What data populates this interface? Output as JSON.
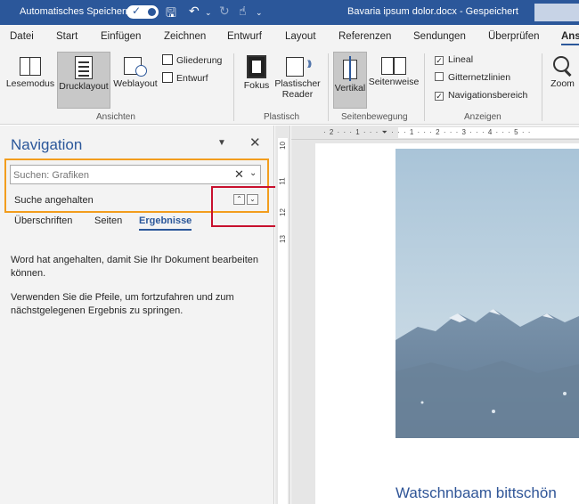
{
  "titlebar": {
    "autosave_label": "Automatisches Speichern",
    "doc_title": "Bavaria ipsum dolor.docx  -  Gespeichert",
    "bg_color": "#2b579a"
  },
  "tabs": [
    "Datei",
    "Start",
    "Einfügen",
    "Zeichnen",
    "Entwurf",
    "Layout",
    "Referenzen",
    "Sendungen",
    "Überprüfen",
    "Ansi"
  ],
  "ribbon": {
    "ansichten": {
      "lesemodus": "Lesemodus",
      "drucklayout": "Drucklayout",
      "weblayout": "Weblayout",
      "gliederung": "Gliederung",
      "entwurf": "Entwurf",
      "label": "Ansichten"
    },
    "plastisch": {
      "fokus": "Fokus",
      "reader_line1": "Plastischer",
      "reader_line2": "Reader",
      "label": "Plastisch"
    },
    "seitenbewegung": {
      "vertikal": "Vertikal",
      "seitenweise": "Seitenweise",
      "label": "Seitenbewegung"
    },
    "anzeigen": {
      "lineal": "Lineal",
      "lineal_checked": true,
      "gitternetzlinien": "Gitternetzlinien",
      "gitternetzlinien_checked": false,
      "navigationsbereich": "Navigationsbereich",
      "navigationsbereich_checked": true,
      "label": "Anzeigen"
    },
    "zoom": "Zoom"
  },
  "nav": {
    "title": "Navigation",
    "search_placeholder": "Suchen: Grafiken",
    "status": "Suche angehalten",
    "tabs": [
      "Überschriften",
      "Seiten",
      "Ergebnisse"
    ],
    "message1": "Word hat angehalten, damit Sie Ihr Dokument bearbeiten können.",
    "message2": "Verwenden Sie die Pfeile, um fortzufahren und zum nächstgelegenen Ergebnis zu springen."
  },
  "ruler": {
    "vertical_numbers": [
      "10",
      "11",
      "12",
      "13"
    ]
  },
  "document": {
    "heading": "Watschnbaam bittschön"
  }
}
